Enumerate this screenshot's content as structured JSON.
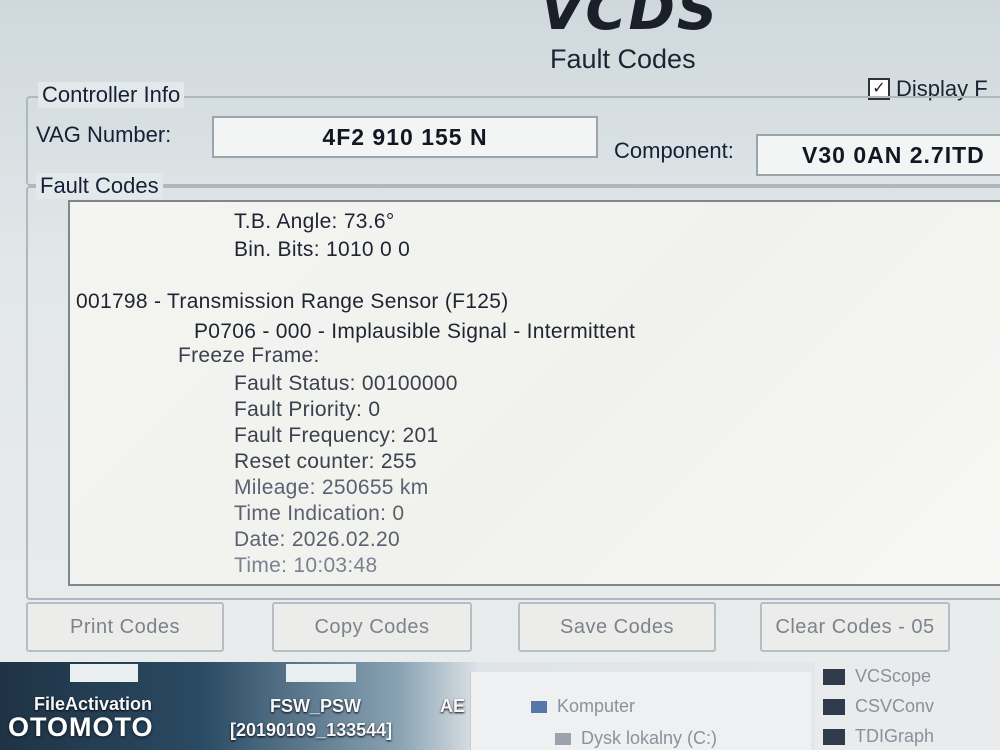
{
  "app": {
    "title": "VCDS",
    "subtitle": "Fault Codes"
  },
  "display_option": {
    "label": "Display F",
    "checked": true
  },
  "controller_info": {
    "legend": "Controller Info",
    "vag_label": "VAG Number:",
    "vag_value": "4F2 910 155 N",
    "component_label": "Component:",
    "component_value": "V30 0AN 2.7ITD"
  },
  "fault_codes": {
    "legend": "Fault Codes",
    "lines": [
      "T.B. Angle: 73.6°",
      "Bin. Bits: 1010 0 0",
      "001798 - Transmission Range Sensor (F125)",
      "P0706 - 000 - Implausible Signal - Intermittent",
      "Freeze Frame:",
      "Fault Status: 00100000",
      "Fault Priority: 0",
      "Fault Frequency: 201",
      "Reset counter: 255",
      "Mileage: 250655 km",
      "Time Indication: 0",
      "Date: 2026.02.20",
      "Time: 10:03:48"
    ]
  },
  "buttons": {
    "print": "Print Codes",
    "copy": "Copy Codes",
    "save": "Save Codes",
    "clear": "Clear Codes - 05"
  },
  "taskbar": {
    "desktop_items": [
      "FileActivation",
      "FSW_PSW",
      "[20190109_133544]",
      "AE"
    ],
    "explorer_items": [
      "Komputer",
      "Dysk lokalny (C:)"
    ],
    "programs": [
      "VCScope",
      "CSVConv",
      "TDIGraph"
    ]
  },
  "watermark": "OTOMOTO"
}
